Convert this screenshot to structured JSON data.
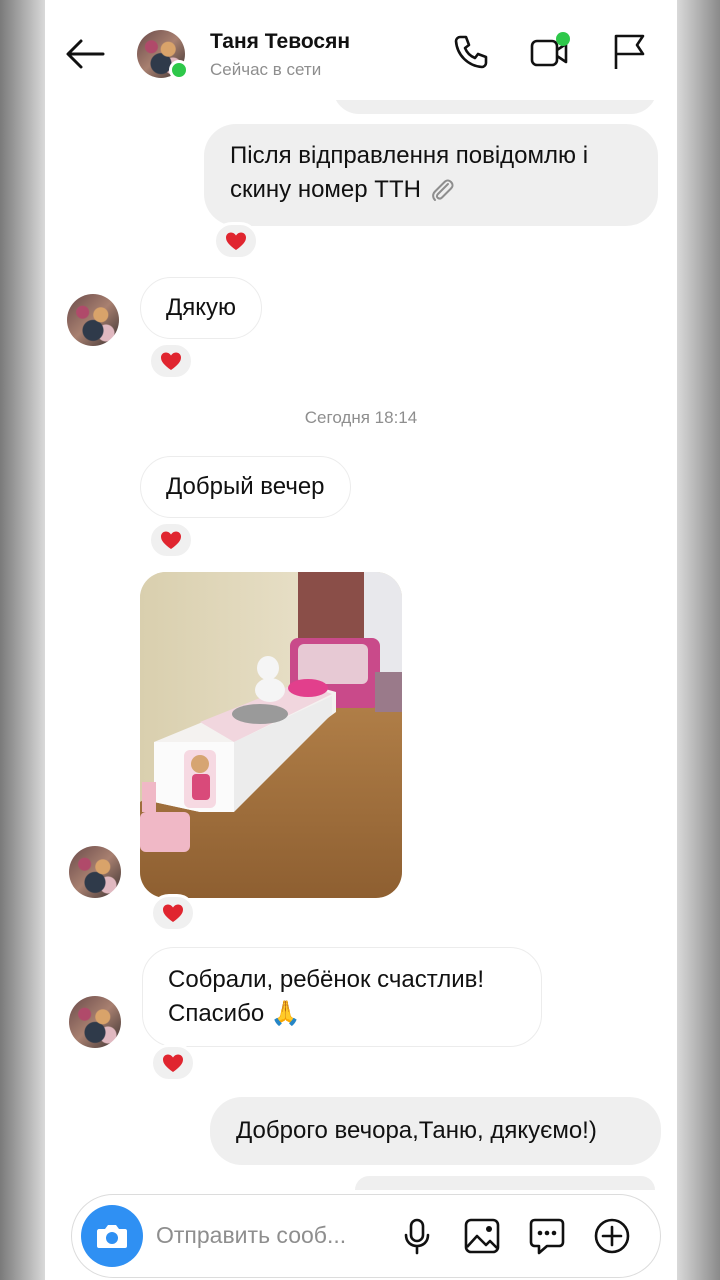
{
  "header": {
    "name": "Таня Тевосян",
    "status": "Сейчас в сети"
  },
  "messages": {
    "m1": "Після відправлення повідомлю і скину номер ТТН 📎",
    "m1_line1": "Після відправлення повідомлю і",
    "m1_line2": "скину номер ТТН",
    "m2": "Дякую",
    "timestamp": "Сегодня 18:14",
    "m3": "Добрый вечер",
    "m5_line1": "Собрали, ребёнок счастлив!",
    "m5_line2": "Спасибо",
    "m5_emoji": "🙏",
    "m6": "Доброго вечора,Таню, дякуємо!)"
  },
  "composer": {
    "placeholder": "Отправить сооб..."
  },
  "colors": {
    "online": "#2ec84a",
    "camera": "#2f90f3",
    "heart": "#e0252f",
    "outgoing_bubble": "#efefef"
  }
}
